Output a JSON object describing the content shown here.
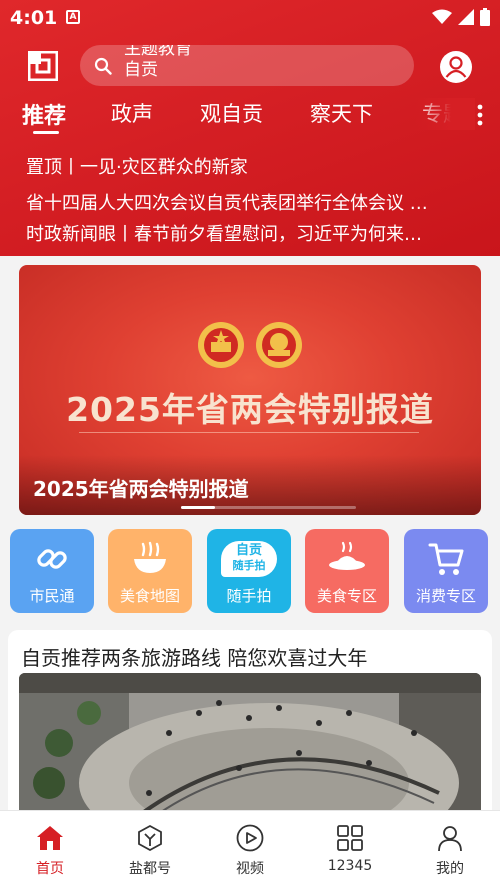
{
  "status_bar": {
    "time": "4:01",
    "notification_icon": "A"
  },
  "search": {
    "lines": [
      "主题教育",
      "自贡"
    ]
  },
  "tabs": [
    {
      "label": "推荐",
      "active": true
    },
    {
      "label": "政声",
      "active": false
    },
    {
      "label": "观自贡",
      "active": false
    },
    {
      "label": "察天下",
      "active": false
    },
    {
      "label": "专题",
      "active": false
    }
  ],
  "headlines": [
    "置顶丨一见·灾区群众的新家",
    "省十四届人大四次会议自贡代表团举行全体会议 …",
    "时政新闻眼丨春节前夕看望慰问，习近平为何来…"
  ],
  "banner": {
    "title": "2025年省两会特别报道",
    "caption": "2025年省两会特别报道"
  },
  "quick_links": [
    {
      "label": "市民通",
      "icon": "link-icon",
      "color": "#5aa3f2"
    },
    {
      "label": "美食地图",
      "icon": "bowl-icon",
      "color": "#ffb36a"
    },
    {
      "label": "随手拍",
      "icon": "snapshot-badge-icon",
      "color": "#1fb4e6",
      "badge_top": "自贡",
      "badge_bottom": "随手拍"
    },
    {
      "label": "美食专区",
      "icon": "dish-icon",
      "color": "#f66b62"
    },
    {
      "label": "消费专区",
      "icon": "cart-icon",
      "color": "#7b8af0"
    }
  ],
  "article": {
    "title": "自贡推荐两条旅游路线 陪您欢喜过大年"
  },
  "bottom_nav": [
    {
      "label": "首页",
      "icon": "home-icon",
      "active": true
    },
    {
      "label": "盐都号",
      "icon": "cube-icon",
      "active": false
    },
    {
      "label": "视频",
      "icon": "play-icon",
      "active": false
    },
    {
      "label": "12345",
      "icon": "grid-icon",
      "active": false
    },
    {
      "label": "我的",
      "icon": "person-icon",
      "active": false
    }
  ],
  "colors": {
    "brand_red": "#d61f24",
    "nav_active": "#d61f24"
  }
}
